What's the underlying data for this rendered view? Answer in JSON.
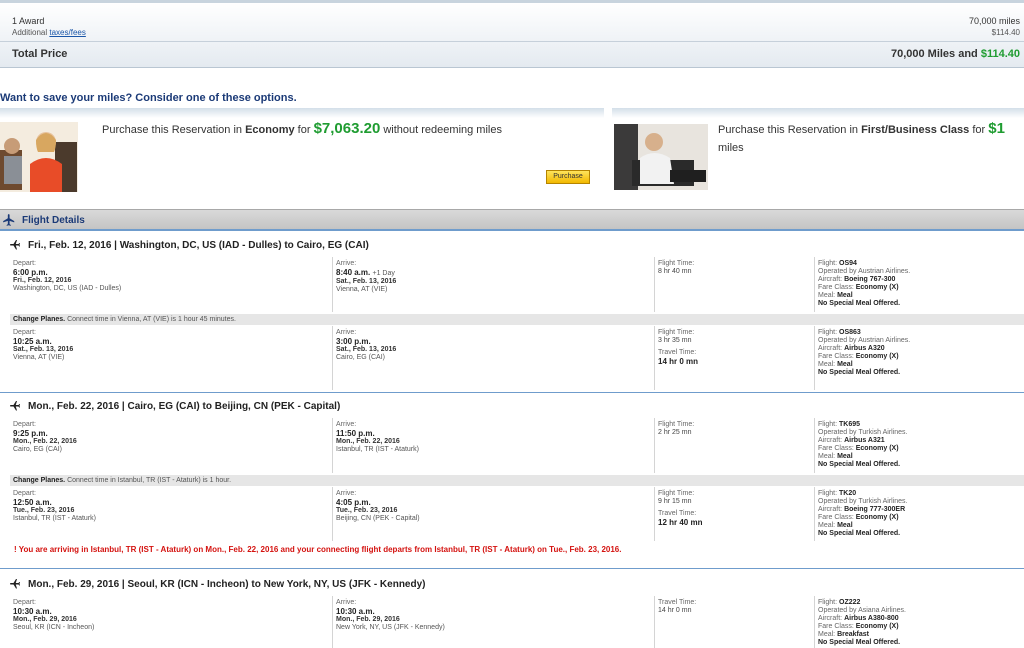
{
  "price": {
    "award_label": "1 Award",
    "additional_label": "Additional",
    "taxes_link": "taxes/fees",
    "miles": "70,000 miles",
    "fees": "$114.40",
    "total_label": "Total Price",
    "total_miles": "70,000 Miles and",
    "total_fees": "$114.40"
  },
  "save": {
    "heading": "Want to save your miles? Consider one of these options.",
    "offer1": {
      "prefix": "Purchase this Reservation in",
      "cabin": "Economy",
      "for_word": "for",
      "price": "$7,063.20",
      "suffix": "without redeeming miles",
      "button": "Purchase"
    },
    "offer2": {
      "prefix": "Purchase this Reservation in",
      "cabin": "First/Business Class",
      "for_word": "for",
      "price": "$1",
      "suffix": "miles"
    }
  },
  "flight_details": {
    "title": "Flight Details"
  },
  "labels": {
    "depart": "Depart:",
    "arrive": "Arrive:",
    "flight_time": "Flight Time:",
    "travel_time": "Travel Time:",
    "flight": "Flight:",
    "aircraft": "Aircraft:",
    "fare_class": "Fare Class:",
    "meal": "Meal:",
    "change_planes": "Change Planes."
  },
  "segments": [
    {
      "title": "Fri., Feb. 12, 2016 | Washington, DC, US (IAD - Dulles) to Cairo, EG (CAI)",
      "legs": [
        {
          "depart_time": "6:00 p.m.",
          "depart_date": "Fri., Feb. 12, 2016",
          "depart_city": "Washington, DC, US (IAD - Dulles)",
          "arrive_time": "8:40 a.m.",
          "arrive_extra": "+1 Day",
          "arrive_date": "Sat., Feb. 13, 2016",
          "arrive_city": "Vienna, AT (VIE)",
          "flight_time": "8 hr 40 mn",
          "flight": "OS94",
          "operated": "Operated by Austrian Airlines.",
          "aircraft": "Boeing 767-300",
          "fare_class": "Economy (X)",
          "meal": "Meal",
          "special": "No Special Meal Offered."
        },
        {
          "depart_time": "10:25 a.m.",
          "depart_date": "Sat., Feb. 13, 2016",
          "depart_city": "Vienna, AT (VIE)",
          "arrive_time": "3:00 p.m.",
          "arrive_extra": "",
          "arrive_date": "Sat., Feb. 13, 2016",
          "arrive_city": "Cairo, EG (CAI)",
          "flight_time": "3 hr 35 mn",
          "travel_time": "14 hr 0 mn",
          "flight": "OS863",
          "operated": "Operated by Austrian Airlines.",
          "aircraft": "Airbus A320",
          "fare_class": "Economy (X)",
          "meal": "Meal",
          "special": "No Special Meal Offered."
        }
      ],
      "change": "Connect time in Vienna, AT (VIE) is 1 hour 45 minutes."
    },
    {
      "title": "Mon., Feb. 22, 2016 | Cairo, EG (CAI) to Beijing, CN (PEK - Capital)",
      "legs": [
        {
          "depart_time": "9:25 p.m.",
          "depart_date": "Mon., Feb. 22, 2016",
          "depart_city": "Cairo, EG (CAI)",
          "arrive_time": "11:50 p.m.",
          "arrive_extra": "",
          "arrive_date": "Mon., Feb. 22, 2016",
          "arrive_city": "Istanbul, TR (IST - Ataturk)",
          "flight_time": "2 hr 25 mn",
          "flight": "TK695",
          "operated": "Operated by Turkish Airlines.",
          "aircraft": "Airbus A321",
          "fare_class": "Economy (X)",
          "meal": "Meal",
          "special": "No Special Meal Offered."
        },
        {
          "depart_time": "12:50 a.m.",
          "depart_date": "Tue., Feb. 23, 2016",
          "depart_city": "Istanbul, TR (IST - Ataturk)",
          "arrive_time": "4:05 p.m.",
          "arrive_extra": "",
          "arrive_date": "Tue., Feb. 23, 2016",
          "arrive_city": "Beijing, CN (PEK - Capital)",
          "flight_time": "9 hr 15 mn",
          "travel_time": "12 hr 40 mn",
          "flight": "TK20",
          "operated": "Operated by Turkish Airlines.",
          "aircraft": "Boeing 777-300ER",
          "fare_class": "Economy (X)",
          "meal": "Meal",
          "special": "No Special Meal Offered."
        }
      ],
      "change": "Connect time in Istanbul, TR (IST - Ataturk) is 1 hour.",
      "warning": "! You are arriving in Istanbul, TR (IST - Ataturk) on Mon., Feb. 22, 2016 and your connecting flight departs from Istanbul, TR (IST - Ataturk) on Tue., Feb. 23, 2016."
    },
    {
      "title": "Mon., Feb. 29, 2016 | Seoul, KR (ICN - Incheon) to New York, NY, US (JFK - Kennedy)",
      "legs": [
        {
          "depart_time": "10:30 a.m.",
          "depart_date": "Mon., Feb. 29, 2016",
          "depart_city": "Seoul, KR (ICN - Incheon)",
          "arrive_time": "10:30 a.m.",
          "arrive_extra": "",
          "arrive_date": "Mon., Feb. 29, 2016",
          "arrive_city": "New York, NY, US (JFK - Kennedy)",
          "flight_time": "14 hr 0 mn",
          "flight": "OZ222",
          "operated": "Operated by Asiana Airlines.",
          "aircraft": "Airbus A380-800",
          "fare_class": "Economy (X)",
          "meal": "Breakfast",
          "special": "No Special Meal Offered."
        }
      ]
    }
  ]
}
